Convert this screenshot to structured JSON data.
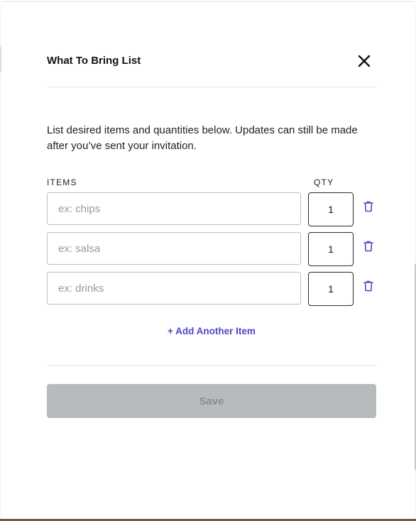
{
  "modal": {
    "title": "What To Bring List",
    "description": "List desired items and quantities below. Updates can still be made after you’ve sent your invitation.",
    "columns": {
      "items": "ITEMS",
      "qty": "QTY"
    },
    "items": [
      {
        "placeholder": "ex: chips",
        "value": "",
        "qty": "1"
      },
      {
        "placeholder": "ex: salsa",
        "value": "",
        "qty": "1"
      },
      {
        "placeholder": "ex: drinks",
        "value": "",
        "qty": "1"
      }
    ],
    "add_item_label": "+ Add Another Item",
    "save_label": "Save"
  },
  "colors": {
    "accent": "#4f46c8",
    "save_disabled_bg": "#b8bbbe",
    "save_disabled_text": "#8a8d91"
  },
  "icons": {
    "close": "close-icon",
    "trash": "trash-icon"
  }
}
